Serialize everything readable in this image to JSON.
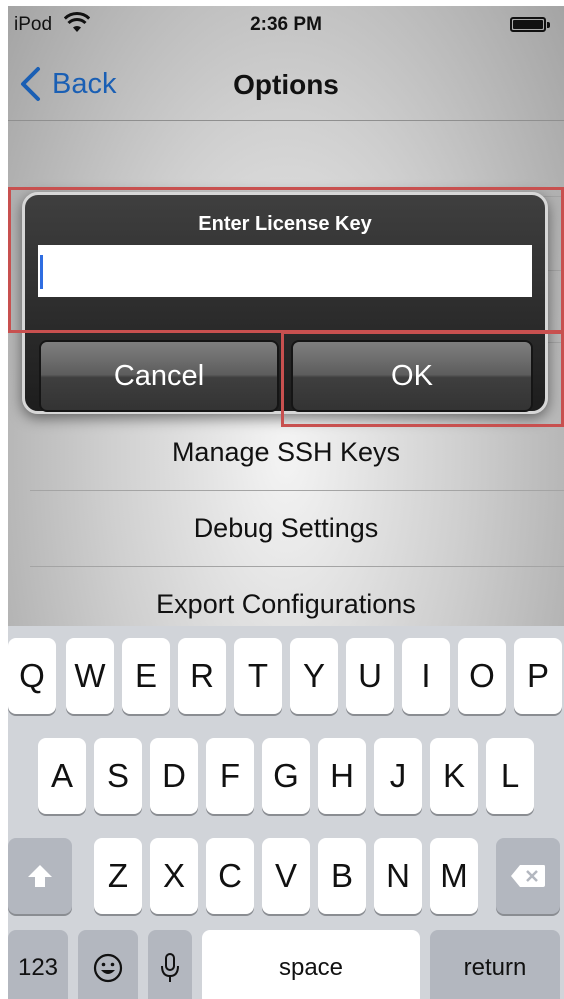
{
  "status_bar": {
    "carrier": "iPod",
    "time": "2:36 PM",
    "wifi_icon": "wifi-icon",
    "battery_icon": "battery-icon"
  },
  "nav": {
    "back_label": "Back",
    "title": "Options",
    "accent": "#1a5fb4"
  },
  "list": {
    "items": [
      "Manage SSH Keys",
      "Debug Settings",
      "Export Configurations"
    ]
  },
  "alert": {
    "title": "Enter License Key",
    "input_value": "",
    "cancel_label": "Cancel",
    "ok_label": "OK"
  },
  "highlight_color": "#c8504f",
  "keyboard": {
    "row1": [
      "Q",
      "W",
      "E",
      "R",
      "T",
      "Y",
      "U",
      "I",
      "O",
      "P"
    ],
    "row2": [
      "A",
      "S",
      "D",
      "F",
      "G",
      "H",
      "J",
      "K",
      "L"
    ],
    "row3": [
      "Z",
      "X",
      "C",
      "V",
      "B",
      "N",
      "M"
    ],
    "numbers_label": "123",
    "space_label": "space",
    "return_label": "return",
    "shift_icon": "shift-icon",
    "delete_icon": "delete-icon",
    "emoji_icon": "emoji-icon",
    "mic_icon": "microphone-icon"
  }
}
